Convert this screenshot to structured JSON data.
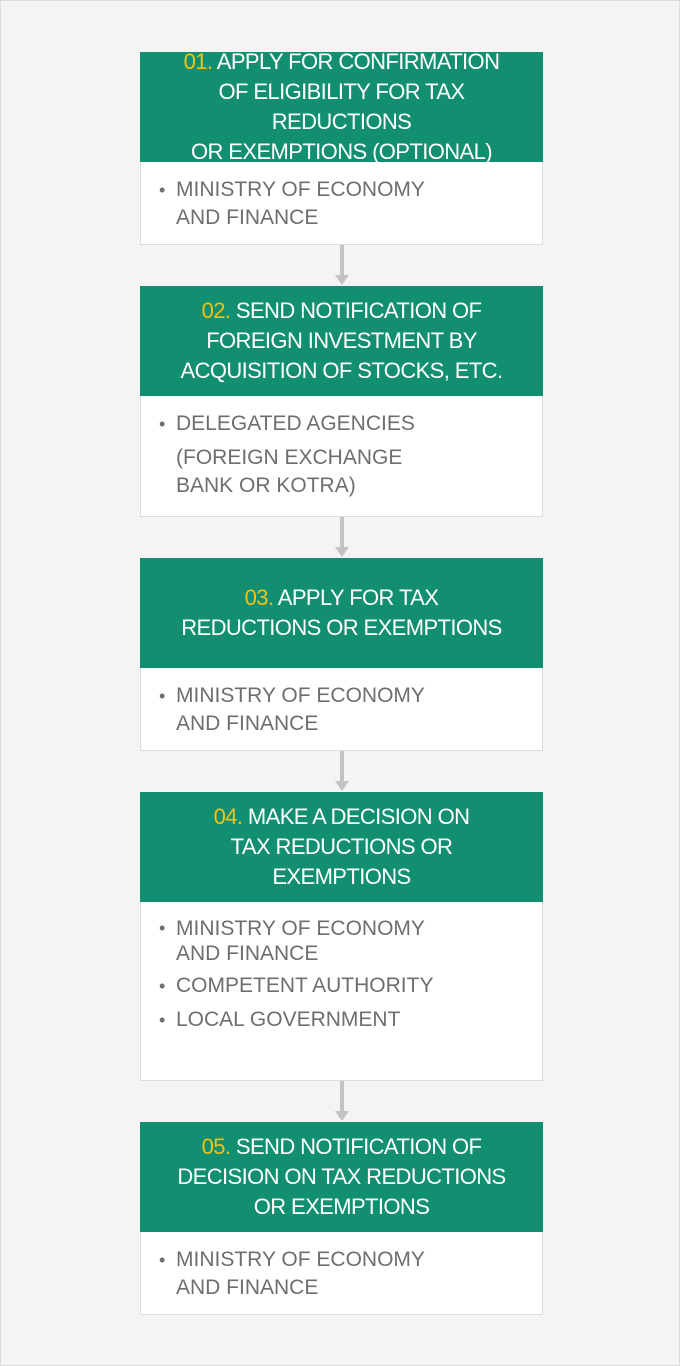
{
  "steps": [
    {
      "number": "01.",
      "title": "APPLY FOR CONFIRMATION\nOF ELIGIBILITY FOR TAX REDUCTIONS\nOR EXEMPTIONS (OPTIONAL)",
      "agencies": [
        "MINISTRY OF ECONOMY\nAND FINANCE"
      ]
    },
    {
      "number": "02.",
      "title": "SEND NOTIFICATION OF\nFOREIGN INVESTMENT BY\nACQUISITION OF STOCKS, ETC.",
      "agencies": [
        "DELEGATED AGENCIES"
      ],
      "note": "(FOREIGN EXCHANGE\nBANK OR KOTRA)"
    },
    {
      "number": "03.",
      "title": "APPLY FOR TAX\nREDUCTIONS OR EXEMPTIONS",
      "agencies": [
        "MINISTRY OF ECONOMY\n AND FINANCE"
      ]
    },
    {
      "number": "04.",
      "title": "MAKE A DECISION ON\nTAX REDUCTIONS OR\nEXEMPTIONS",
      "agencies": [
        "MINISTRY OF ECONOMY\nAND FINANCE",
        "COMPETENT AUTHORITY",
        "LOCAL GOVERNMENT"
      ]
    },
    {
      "number": "05.",
      "title": "SEND NOTIFICATION OF\nDECISION ON TAX REDUCTIONS\nOR EXEMPTIONS",
      "agencies": [
        "MINISTRY OF ECONOMY\n AND FINANCE"
      ]
    }
  ],
  "bullet": "•",
  "colors": {
    "header_bg": "#128f70",
    "step_number": "#f2c313",
    "body_text": "#6e6e6e",
    "arrow": "#c3c3c3",
    "background": "#f4f4f4"
  }
}
